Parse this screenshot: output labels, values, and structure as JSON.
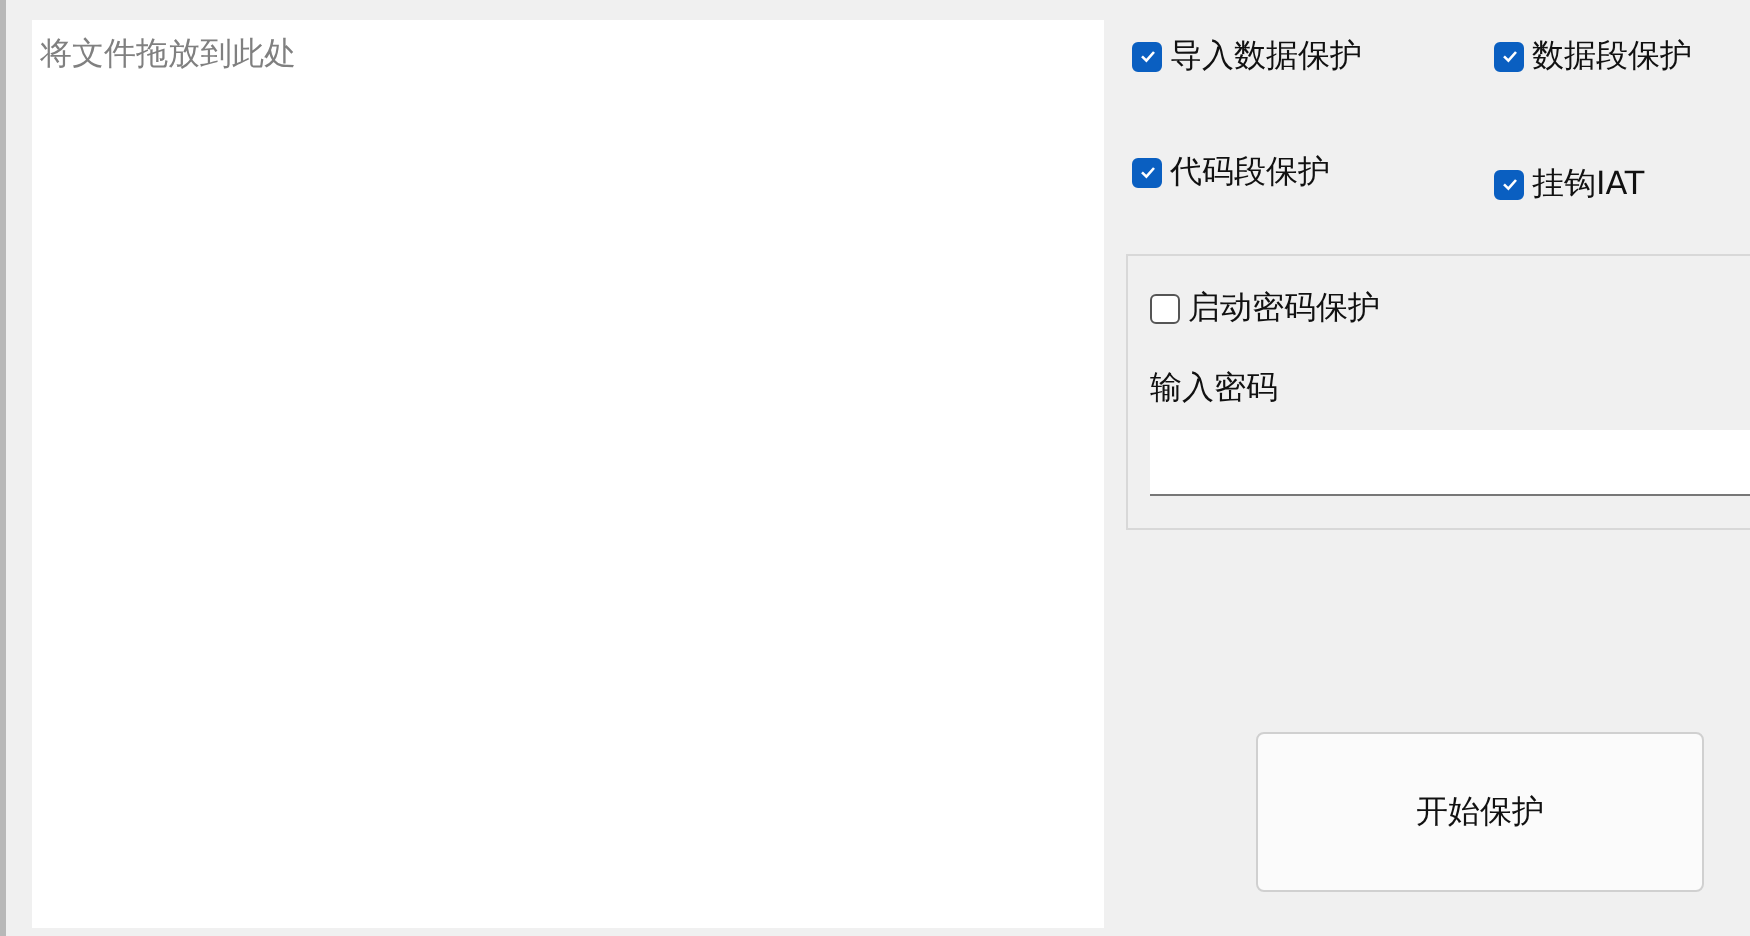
{
  "drop_area": {
    "placeholder": "将文件拖放到此处"
  },
  "options": [
    {
      "label": "导入数据保护",
      "checked": true
    },
    {
      "label": "数据段保护",
      "checked": true
    },
    {
      "label": "代码段保护",
      "checked": true
    },
    {
      "label": "挂钩IAT",
      "checked": true
    }
  ],
  "password_group": {
    "enable": {
      "label": "启动密码保护",
      "checked": false
    },
    "label": "输入密码"
  },
  "start_button": {
    "label": "开始保护"
  }
}
